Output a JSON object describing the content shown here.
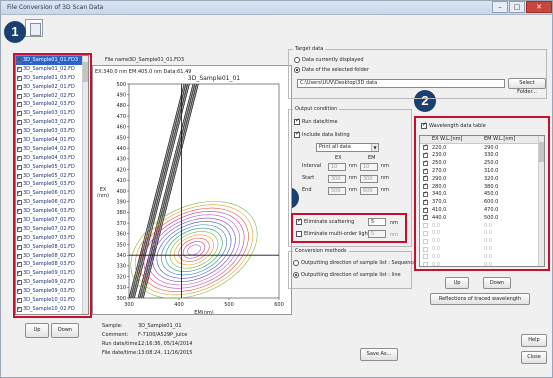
{
  "window": {
    "title": "File Conversion of 3D Scan Data"
  },
  "badges": [
    "1",
    "2",
    "3"
  ],
  "file_list": [
    "3D_Sample01_01.FD3",
    "3D_Sample01_02.FD",
    "3D_Sample01_03.FD",
    "3D_Sample02_01.FD",
    "3D_Sample02_02.FD",
    "3D_Sample02_03.FD",
    "3D_Sample03_01.FD",
    "3D_Sample03_02.FD",
    "3D_Sample03_03.FD",
    "3D_Sample04_01.FD",
    "3D_Sample04_02.FD",
    "3D_Sample04_03.FD",
    "3D_Sample05_01.FD",
    "3D_Sample05_02.FD",
    "3D_Sample05_03.FD",
    "3D_Sample06_01.FD",
    "3D_Sample06_02.FD",
    "3D_Sample06_03.FD",
    "3D_Sample07_01.FD",
    "3D_Sample07_02.FD",
    "3D_Sample07_03.FD",
    "3D_Sample08_01.FD",
    "3D_Sample08_02.FD",
    "3D_Sample08_03.FD",
    "3D_Sample09_01.FD",
    "3D_Sample09_02.FD",
    "3D_Sample09_03.FD",
    "3D_Sample10_01.FD",
    "3D_Sample10_02.FD"
  ],
  "file_name_label": "File name:",
  "file_name_value": "3D_Sample01_01.FD3",
  "cursor_readout": "EX:340.0 nm  EM:405.0 nm  Data:61.49",
  "chart_data": {
    "type": "heatmap",
    "title": "3D_Sample01_01",
    "xlabel": "EM(nm)",
    "ylabel": "EX\n(nm)",
    "x_ticks": [
      300,
      400,
      500,
      600
    ],
    "y_ticks": [
      300,
      310,
      320,
      330,
      340,
      350,
      360,
      370,
      380,
      390,
      400,
      410,
      420,
      430,
      440,
      450,
      460,
      470,
      480,
      490,
      500
    ],
    "xlim": [
      300,
      600
    ],
    "ylim": [
      300,
      500
    ],
    "cursor": {
      "ex": 340.0,
      "em": 405.0
    }
  },
  "left_buttons": {
    "up": "Up",
    "down": "Down"
  },
  "sample_info": [
    {
      "label": "Sample:",
      "value": "3D_Sample01_01"
    },
    {
      "label": "Comment:",
      "value": "F-7100/A529P_juice"
    },
    {
      "label": "Run date/time:",
      "value": "12:16:36, 05/14/2014"
    },
    {
      "label": "File date/time:",
      "value": "13:08:24, 11/16/2015"
    }
  ],
  "target": {
    "title": "Target data",
    "opt1": "Data currently displayed",
    "opt2": "Data of the selected folder",
    "path": "C:\\Users\\UUV\\Desktop\\3D data",
    "select_folder": "Select Folder..."
  },
  "output": {
    "title": "Output condition",
    "run_date": "Run date/time",
    "include_data_listing": "Include data listing",
    "print_option": "Print all data",
    "col_ex": "EX",
    "col_em": "EM",
    "rows": [
      {
        "label": "Interval",
        "ex": "10",
        "em": "10",
        "unit": "nm"
      },
      {
        "label": "Start",
        "ex": "300",
        "em": "300",
        "unit": "nm"
      },
      {
        "label": "End",
        "ex": "500",
        "em": "600",
        "unit": "nm"
      }
    ],
    "eliminate_scattering": "Eliminate scattering",
    "scattering_value": "5",
    "eliminate_multi": "Eliminate multi-order light",
    "multi_value": "5",
    "unit": "nm"
  },
  "conversion": {
    "title": "Conversion methods",
    "opt1": "Outputting direction of sample list : Sequence",
    "opt2": "Outputting direction of sample list : line"
  },
  "wavelength_table": {
    "toggle": "Wavelength data table",
    "col_ex": "EX W.L.[nm]",
    "col_em": "EM W.L.[nm]",
    "rows": [
      {
        "ex": "220.0",
        "em": "290.0",
        "on": true
      },
      {
        "ex": "230.0",
        "em": "330.0",
        "on": true
      },
      {
        "ex": "250.0",
        "em": "250.0",
        "on": true
      },
      {
        "ex": "270.0",
        "em": "310.0",
        "on": true
      },
      {
        "ex": "290.0",
        "em": "320.0",
        "on": true
      },
      {
        "ex": "280.0",
        "em": "380.0",
        "on": true
      },
      {
        "ex": "340.0",
        "em": "450.0",
        "on": true
      },
      {
        "ex": "370.0",
        "em": "600.0",
        "on": true
      },
      {
        "ex": "410.0",
        "em": "470.0",
        "on": true
      },
      {
        "ex": "440.0",
        "em": "500.0",
        "on": true
      },
      {
        "ex": "0.0",
        "em": "0.0",
        "on": false
      },
      {
        "ex": "0.0",
        "em": "0.0",
        "on": false
      },
      {
        "ex": "0.0",
        "em": "0.0",
        "on": false
      },
      {
        "ex": "0.0",
        "em": "0.0",
        "on": false
      },
      {
        "ex": "0.0",
        "em": "0.0",
        "on": false
      },
      {
        "ex": "0.0",
        "em": "0.0",
        "on": false
      }
    ],
    "up": "Up",
    "down": "Down",
    "reflections": "Reflections of traced wavelength"
  },
  "bottom": {
    "save_as": "Save As...",
    "help": "Help",
    "close": "Close"
  },
  "colors": {
    "accent_red": "#c8102e",
    "badge_navy": "#1b3f6e",
    "selection_blue": "#2a63c9"
  }
}
